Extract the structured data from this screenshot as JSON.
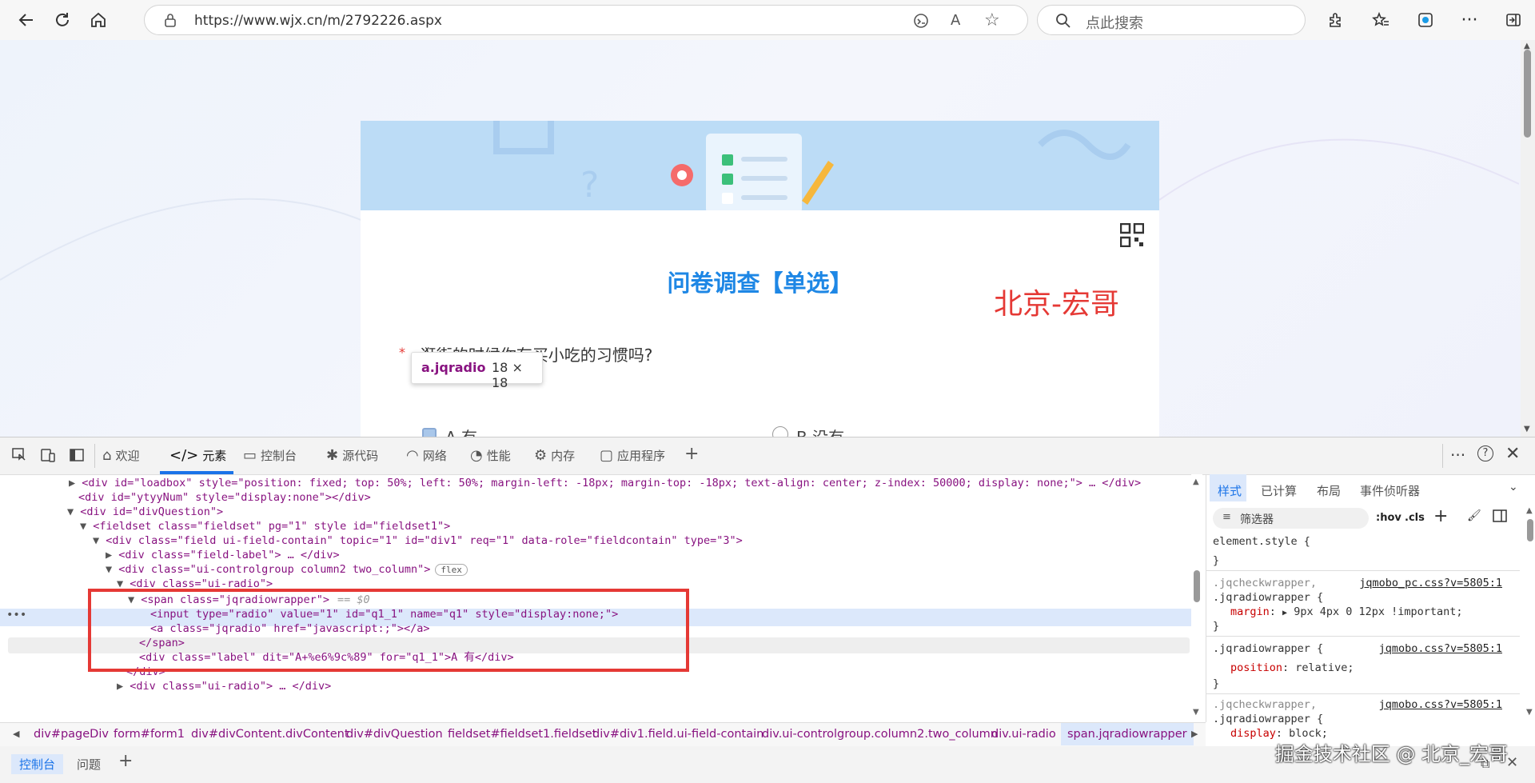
{
  "browser": {
    "url": "https://www.wjx.cn/m/2792226.aspx",
    "search_placeholder": "点此搜索"
  },
  "survey": {
    "title": "问卷调查【单选】",
    "watermark_text": "北京-宏哥",
    "question_visible": "· 逛街的时候你有买小吃的习惯吗?",
    "tooltip_selector": "a.jqradio",
    "tooltip_size": "18 × 18",
    "option_a": "A 有",
    "option_b": "B 没有"
  },
  "devtools": {
    "tabs": [
      "欢迎",
      "元素",
      "控制台",
      "源代码",
      "网络",
      "性能",
      "内存",
      "应用程序"
    ],
    "styles_tabs": [
      "样式",
      "已计算",
      "布局",
      "事件侦听器"
    ],
    "filter_placeholder": "筛选器",
    "hov": ":hov",
    "cls": ".cls",
    "flex_badge": "flex",
    "dollar0": "== $0",
    "drawer_tabs": [
      "控制台",
      "问题"
    ],
    "breadcrumbs": [
      "div#pageDiv",
      "form#form1",
      "div#divContent.divContent",
      "div#divQuestion",
      "fieldset#fieldset1.fieldset",
      "div#div1.field.ui-field-contain",
      "div.ui-controlgroup.column2.two_column",
      "div.ui-radio",
      "span.jqradiowrapper"
    ],
    "dom_lines": [
      "<div id=\"loadbox\" style=\"position: fixed; top: 50%; left: 50%; margin-left: -18px; margin-top: -18px; text-align: center; z-index: 50000; display: none;\"> … </div>",
      "<div id=\"ytyyNum\" style=\"display:none\"></div>",
      "<div id=\"divQuestion\">",
      "<fieldset class=\"fieldset\" pg=\"1\" style id=\"fieldset1\">",
      "<div class=\"field ui-field-contain\" topic=\"1\" id=\"div1\" req=\"1\" data-role=\"fieldcontain\" type=\"3\">",
      "<div class=\"field-label\"> … </div>",
      "<div class=\"ui-controlgroup column2 two_column\">",
      "<div class=\"ui-radio\">",
      "<span class=\"jqradiowrapper\">",
      "<input type=\"radio\" value=\"1\" id=\"q1_1\" name=\"q1\" style=\"display:none;\">",
      "<a class=\"jqradio\" href=\"javascript:;\"></a>",
      "</span>",
      "<div class=\"label\" dit=\"A+%e6%9c%89\" for=\"q1_1\">A 有</div>",
      "</div>",
      "<div class=\"ui-radio\"> … </div>"
    ],
    "css": {
      "element_style": "element.style {",
      "close": "}",
      "rule1_sel1": ".jqcheckwrapper,",
      "rule1_sel2": ".jqradiowrapper {",
      "rule1_src": "jqmobo_pc.css?v=5805:1",
      "rule1_prop": "margin",
      "rule1_val": "9px 4px 0 12px !important;",
      "rule2_sel": ".jqradiowrapper {",
      "rule2_src": "jqmobo.css?v=5805:1",
      "rule2_prop": "position",
      "rule2_val": "relative;",
      "rule3_sel1": ".jqcheckwrapper,",
      "rule3_sel2": ".jqradiowrapper {",
      "rule3_src": "jqmobo.css?v=5805:1",
      "rule3_prop": "display",
      "rule3_val": "block;"
    }
  },
  "site_watermark": "掘金技术社区 @ 北京_宏哥"
}
